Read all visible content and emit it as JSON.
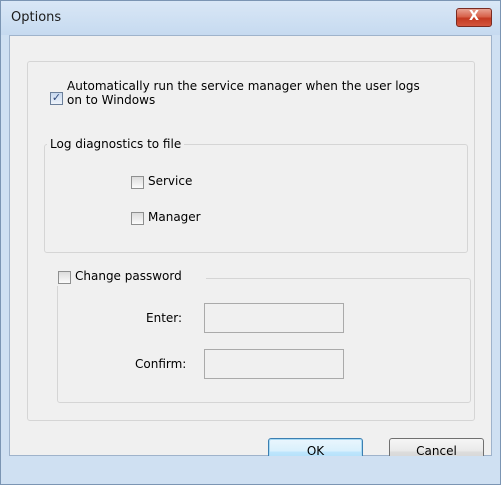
{
  "window": {
    "title": "Options",
    "close_glyph": "X"
  },
  "auto_run": {
    "checked": true,
    "label_line1": "Automatically run the service manager when the user logs",
    "label_line2": "on to Windows"
  },
  "log_group": {
    "legend": "Log diagnostics to file",
    "service": {
      "label": "Service",
      "checked": false
    },
    "manager": {
      "label": "Manager",
      "checked": false
    }
  },
  "password_group": {
    "checkbox_label": "Change password",
    "checked": false,
    "enter_label": "Enter:",
    "enter_value": "",
    "confirm_label": "Confirm:",
    "confirm_value": ""
  },
  "buttons": {
    "ok_label": "OK",
    "cancel_label": "Cancel"
  },
  "icons": {
    "checkmark": "✓"
  }
}
